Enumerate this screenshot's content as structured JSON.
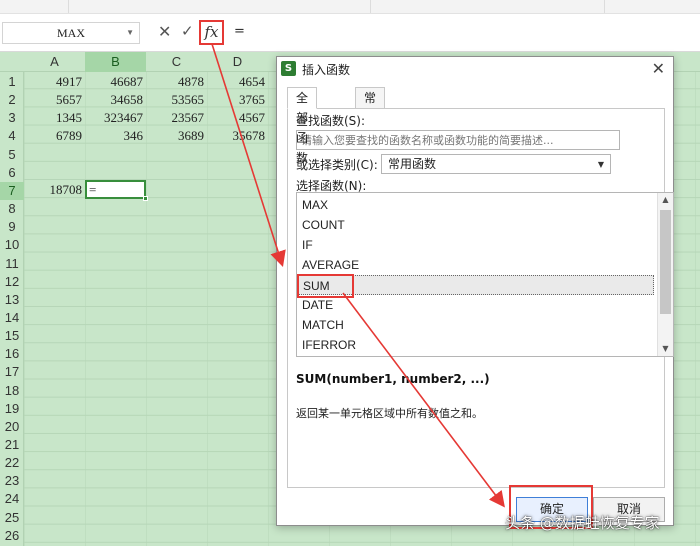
{
  "formula_bar": {
    "name_box": "MAX",
    "cancel_glyph": "✕",
    "enter_glyph": "✓",
    "fx_label": "fx",
    "value": "="
  },
  "sheet": {
    "columns": [
      "A",
      "B",
      "C",
      "D"
    ],
    "selected_column": "B",
    "rows": [
      "1",
      "2",
      "3",
      "4",
      "5",
      "6",
      "7",
      "8",
      "9",
      "10",
      "11",
      "12",
      "13",
      "14",
      "15",
      "16",
      "17",
      "18",
      "19",
      "20",
      "21",
      "22",
      "23",
      "24",
      "25",
      "26"
    ],
    "selected_row": "7",
    "cells": {
      "r1": [
        "4917",
        "46687",
        "4878",
        "4654"
      ],
      "r2": [
        "5657",
        "34658",
        "53565",
        "3765"
      ],
      "r3": [
        "1345",
        "323467",
        "23567",
        "4567"
      ],
      "r4": [
        "6789",
        "346",
        "3689",
        "35678"
      ],
      "a7": "18708",
      "b7": "="
    }
  },
  "dialog": {
    "title": "插入函数",
    "logo": "S",
    "close_glyph": "✕",
    "tabs": [
      "全部函数",
      "常用公式"
    ],
    "search_label": "查找函数(S):",
    "search_placeholder": "请输入您要查找的函数名称或函数功能的简要描述...",
    "category_label": "或选择类别(C):",
    "category_value": "常用函数",
    "list_label": "选择函数(N):",
    "functions": [
      "MAX",
      "COUNT",
      "IF",
      "AVERAGE",
      "SUM",
      "DATE",
      "MATCH",
      "IFERROR"
    ],
    "selected_function": "SUM",
    "signature": "SUM(number1, number2, ...)",
    "description": "返回某一单元格区域中所有数值之和。",
    "ok_label": "确定",
    "cancel_label": "取消"
  },
  "watermark": "头条 @数据蛙恢复专家",
  "colors": {
    "sheet_bg": "#c8e6c9",
    "highlight_red": "#e53935",
    "selection_green": "#388e3c"
  }
}
